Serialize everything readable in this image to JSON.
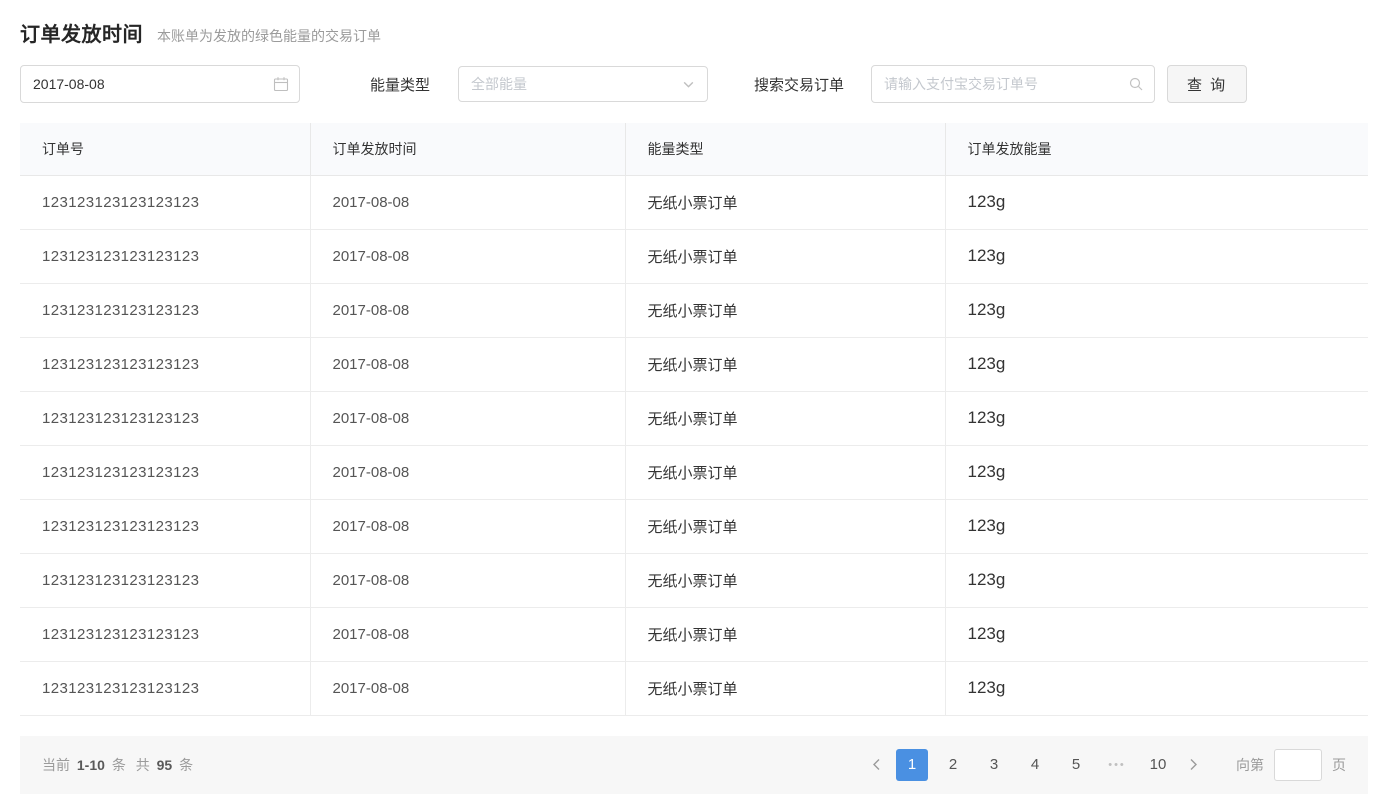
{
  "page": {
    "title": "订单发放时间",
    "subtitle": "本账单为发放的绿色能量的交易订单"
  },
  "filters": {
    "date_value": "2017-08-08",
    "energy_type_label": "能量类型",
    "energy_type_placeholder": "全部能量",
    "search_label": "搜索交易订单",
    "search_placeholder": "请输入支付宝交易订单号",
    "query_button": "查 询"
  },
  "table": {
    "columns": [
      "订单号",
      "订单发放时间",
      "能量类型",
      "订单发放能量"
    ],
    "rows": [
      {
        "order_no": "123123123123123123",
        "issue_time": "2017-08-08",
        "energy_type": "无纸小票订单",
        "energy": "123g"
      },
      {
        "order_no": "123123123123123123",
        "issue_time": "2017-08-08",
        "energy_type": "无纸小票订单",
        "energy": "123g"
      },
      {
        "order_no": "123123123123123123",
        "issue_time": "2017-08-08",
        "energy_type": "无纸小票订单",
        "energy": "123g"
      },
      {
        "order_no": "123123123123123123",
        "issue_time": "2017-08-08",
        "energy_type": "无纸小票订单",
        "energy": "123g"
      },
      {
        "order_no": "123123123123123123",
        "issue_time": "2017-08-08",
        "energy_type": "无纸小票订单",
        "energy": "123g"
      },
      {
        "order_no": "123123123123123123",
        "issue_time": "2017-08-08",
        "energy_type": "无纸小票订单",
        "energy": "123g"
      },
      {
        "order_no": "123123123123123123",
        "issue_time": "2017-08-08",
        "energy_type": "无纸小票订单",
        "energy": "123g"
      },
      {
        "order_no": "123123123123123123",
        "issue_time": "2017-08-08",
        "energy_type": "无纸小票订单",
        "energy": "123g"
      },
      {
        "order_no": "123123123123123123",
        "issue_time": "2017-08-08",
        "energy_type": "无纸小票订单",
        "energy": "123g"
      },
      {
        "order_no": "123123123123123123",
        "issue_time": "2017-08-08",
        "energy_type": "无纸小票订单",
        "energy": "123g"
      }
    ]
  },
  "pagination": {
    "summary_prefix": "当前",
    "range": "1-10",
    "range_unit": "条",
    "total_prefix": "共",
    "total": "95",
    "total_unit": "条",
    "pages": [
      "1",
      "2",
      "3",
      "4",
      "5",
      "•••",
      "10"
    ],
    "active_page": "1",
    "jump_label": "向第",
    "jump_unit": "页",
    "jump_value": ""
  },
  "colors": {
    "accent": "#4a90e2",
    "table_header_bg": "#f9fafc",
    "footer_bg": "#f7f7f7"
  }
}
